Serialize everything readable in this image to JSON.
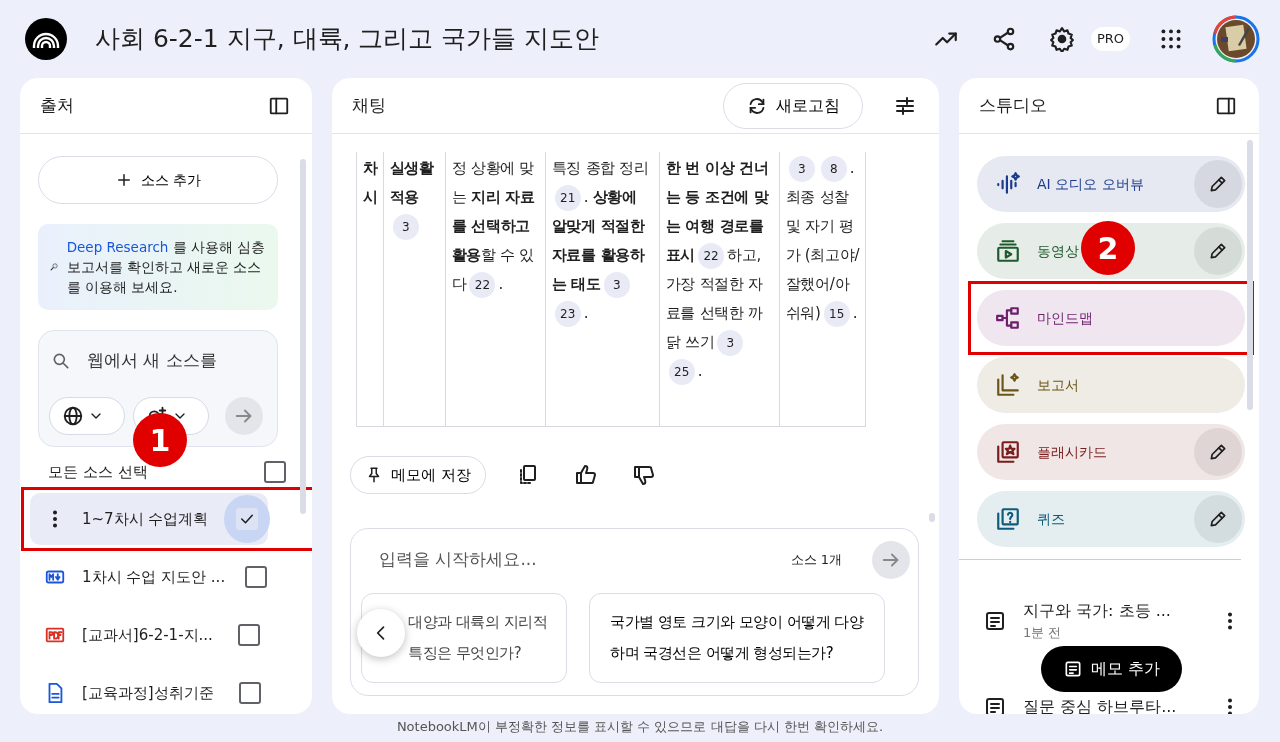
{
  "app": {
    "title": "사회 6-2-1 지구, 대륙, 그리고 국가들 지도안",
    "badge": "PRO"
  },
  "sources_panel": {
    "title": "출처",
    "add_button": "소스 추가",
    "deep_research": {
      "link": "Deep Research",
      "text": " 를 사용해 심층 보고서를 확인하고 새로운 소스를 이용해 보세요."
    },
    "search": {
      "placeholder": "웹에서 새 소스를"
    },
    "select_all": {
      "label": "모든 소스 선택",
      "checked": false,
      "callout": "1"
    },
    "sources": [
      {
        "kind": "menu",
        "title": "1~7차시 수업계획",
        "checked": true,
        "selected": true,
        "highlighted": true
      },
      {
        "kind": "markdown",
        "title": "1차시 수업 지도안 ...",
        "checked": false,
        "selected": false,
        "highlighted": false
      },
      {
        "kind": "pdf",
        "title": "[교과서]6-2-1-지...",
        "checked": false,
        "selected": false,
        "highlighted": false
      },
      {
        "kind": "doc",
        "title": "[교육과정]성취기준",
        "checked": false,
        "selected": false,
        "highlighted": false
      }
    ]
  },
  "chat": {
    "title": "채팅",
    "refresh_button": "새로고침",
    "table": {
      "rows": [
        [
          {
            "bold": true,
            "parts": [
              {
                "kind": "text",
                "text": "차시"
              }
            ]
          },
          {
            "bold": true,
            "parts": [
              {
                "kind": "text",
                "text": "실생활 적용"
              },
              {
                "kind": "cite",
                "text": "3"
              }
            ]
          },
          {
            "bold": false,
            "parts": [
              {
                "kind": "text",
                "text": "정 상황에 맞는 **지리 자료를 선택하고 활용**할 수 있다"
              },
              {
                "kind": "cite",
                "text": "22"
              },
              {
                "kind": "text",
                "text": "."
              }
            ]
          },
          {
            "bold": false,
            "parts": [
              {
                "kind": "text",
                "text": "특징 종합 정리"
              },
              {
                "kind": "cite",
                "text": "21"
              },
              {
                "kind": "text",
                "text": ". **상황에 알맞게 적절한 자료를 활용하는 태도**"
              },
              {
                "kind": "cite",
                "text": "3"
              },
              {
                "kind": "cite",
                "text": "23"
              },
              {
                "kind": "text",
                "text": "."
              }
            ]
          },
          {
            "bold": false,
            "parts": [
              {
                "kind": "text",
                "text": "**한 번 이상 건너는 등 조건에 맞는 여행 경로를 표시**"
              },
              {
                "kind": "cite",
                "text": "22"
              },
              {
                "kind": "text",
                "text": "하고, 가장 적절한 자료를 선택한 까닭 쓰기"
              },
              {
                "kind": "cite",
                "text": "3"
              },
              {
                "kind": "cite",
                "text": "25"
              },
              {
                "kind": "text",
                "text": "."
              }
            ]
          },
          {
            "bold": false,
            "parts": [
              {
                "kind": "cite",
                "text": "3"
              },
              {
                "kind": "cite",
                "text": "8"
              },
              {
                "kind": "text",
                "text": ". 최종 성찰 및 자기 평가 (최고야/잘했어/아쉬워)"
              },
              {
                "kind": "cite",
                "text": "15"
              },
              {
                "kind": "text",
                "text": "."
              }
            ]
          }
        ]
      ]
    },
    "save_button": "메모에 저장",
    "composer": {
      "placeholder": "입력을 시작하세요...",
      "source_count": "소스 1개"
    },
    "suggestions": [
      "대양과 대륙의 지리적 특징은 무엇인가?",
      "국가별 영토 크기와 모양이 어떻게 다양하며 국경선은 어떻게 형성되는가?"
    ]
  },
  "studio": {
    "title": "스튜디오",
    "tiles": [
      {
        "kind": "audio",
        "label": "AI 오디오 오버뷰",
        "color": "#1b3b8c",
        "editable": true,
        "highlighted": false
      },
      {
        "kind": "video",
        "label": "동영상",
        "color": "#1e5a2c",
        "editable": true,
        "highlighted": false,
        "callout": "2"
      },
      {
        "kind": "mindmap",
        "label": "마인드맵",
        "color": "#6e1f6e",
        "editable": false,
        "highlighted": true
      },
      {
        "kind": "report",
        "label": "보고서",
        "color": "#6b5518",
        "editable": false,
        "highlighted": false
      },
      {
        "kind": "flashcards",
        "label": "플래시카드",
        "color": "#7a1d1d",
        "editable": true,
        "highlighted": false
      },
      {
        "kind": "quiz",
        "label": "퀴즈",
        "color": "#0e5b7a",
        "editable": true,
        "highlighted": false
      }
    ],
    "notes": [
      {
        "title": "지구와 국가: 초등 ...",
        "time": "1분 전"
      },
      {
        "title": "질문 중심 하브루타..."
      }
    ],
    "add_note_button": "메모 추가"
  },
  "footer": "NotebookLM이 부정확한 정보를 표시할 수 있으므로 대답을 다시 한번 확인하세요."
}
